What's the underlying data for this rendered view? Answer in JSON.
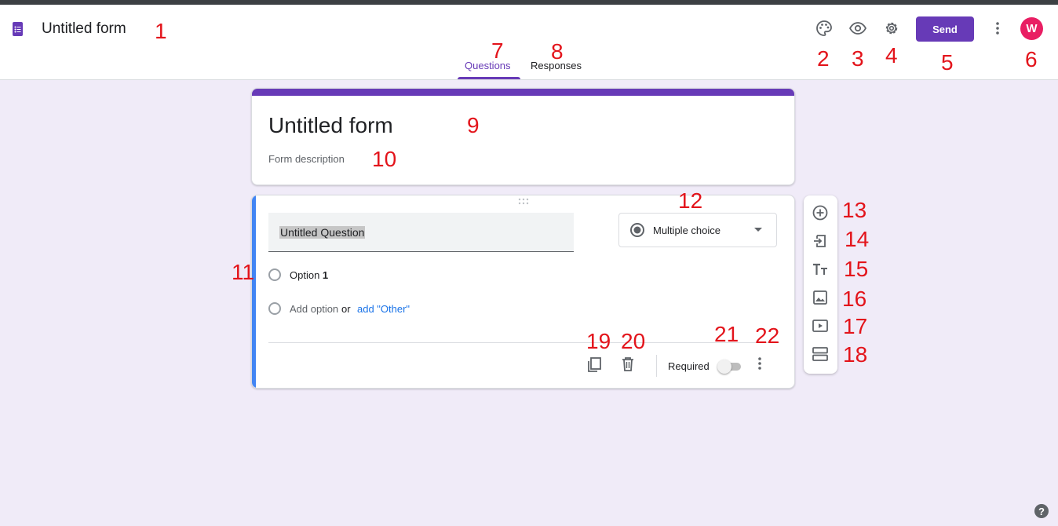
{
  "header": {
    "doc_title": "Untitled form",
    "send_label": "Send",
    "avatar_initial": "W",
    "tabs": [
      {
        "label": "Questions",
        "active": true
      },
      {
        "label": "Responses",
        "active": false
      }
    ],
    "icons": [
      "palette-icon",
      "preview-eye-icon",
      "settings-gear-icon",
      "more-vert-icon"
    ]
  },
  "form": {
    "title": "Untitled form",
    "description_placeholder": "Form description"
  },
  "question": {
    "title": "Untitled Question",
    "type": "Multiple choice",
    "option_prefix": "Option ",
    "option_num": "1",
    "add_option": "Add option",
    "or": "or",
    "add_other": "add \"Other\"",
    "required_label": "Required",
    "required": false
  },
  "side_toolbar": [
    "add-question-icon",
    "import-questions-icon",
    "add-title-icon",
    "add-image-icon",
    "add-video-icon",
    "add-section-icon"
  ],
  "annotations": [
    "1",
    "2",
    "3",
    "4",
    "5",
    "6",
    "7",
    "8",
    "9",
    "10",
    "11",
    "12",
    "13",
    "14",
    "15",
    "16",
    "17",
    "18",
    "19",
    "20",
    "21",
    "22"
  ],
  "help": "?",
  "colors": {
    "accent": "#673ab7",
    "background": "#f0ebf8",
    "question_bar": "#4285f4",
    "avatar": "#e91e63",
    "annotation": "#e3141b"
  }
}
